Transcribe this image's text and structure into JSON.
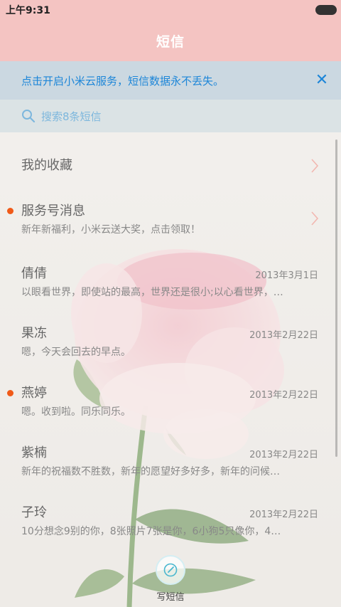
{
  "status_bar": {
    "time": "上午9:31"
  },
  "header": {
    "title": "短信"
  },
  "banner": {
    "text": "点击开启小米云服务，短信数据永不丢失。",
    "close_icon": "close-icon"
  },
  "search": {
    "placeholder": "搜索8条短信",
    "icon": "search-icon"
  },
  "list": {
    "items": [
      {
        "title": "我的收藏",
        "preview": "",
        "date": "",
        "unread": false,
        "chevron": true
      },
      {
        "title": "服务号消息",
        "preview": "新年新福利，小米云送大奖，点击领取！",
        "date": "",
        "unread": true,
        "chevron": true
      },
      {
        "title": "倩倩",
        "preview": "以眼看世界，即使站的最高，世界还是很小;以心看世界，…",
        "date": "2013年3月1日",
        "unread": false,
        "chevron": false
      },
      {
        "title": "果冻",
        "preview": "嗯，今天会回去的早点。",
        "date": "2013年2月22日",
        "unread": false,
        "chevron": false
      },
      {
        "title": "燕婷",
        "preview": "嗯。收到啦。同乐同乐。",
        "date": "2013年2月22日",
        "unread": true,
        "chevron": false
      },
      {
        "title": "紫楠",
        "preview": "新年的祝福数不胜数，新年的愿望好多好多，新年的问候…",
        "date": "2013年2月22日",
        "unread": false,
        "chevron": false
      },
      {
        "title": "子玲",
        "preview": "10分想念9别的你，8张照片7张是你，6小狗5只像你，4…",
        "date": "2013年2月22日",
        "unread": false,
        "chevron": false
      }
    ]
  },
  "compose": {
    "label": "写短信",
    "icon": "compose-icon"
  },
  "colors": {
    "header_bg": "#f4c4c2",
    "accent_blue": "#1d86d8",
    "unread_dot": "#f05a18"
  }
}
